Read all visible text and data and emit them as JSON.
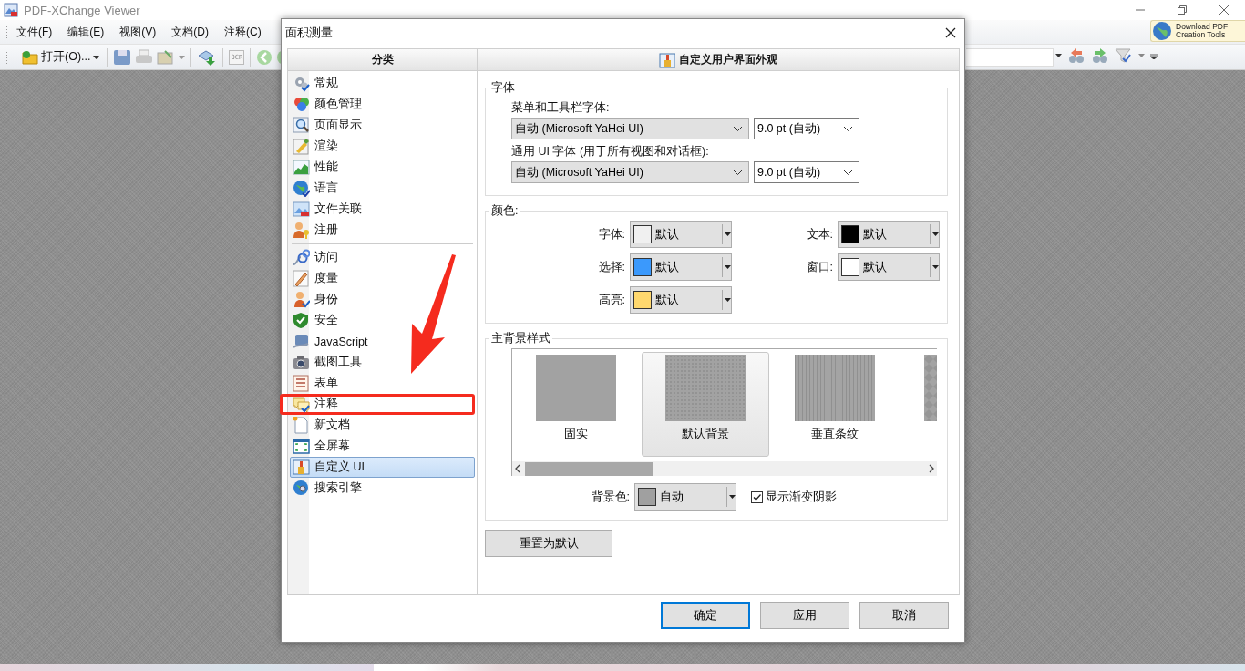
{
  "app": {
    "title": "PDF-XChange Viewer",
    "menu": [
      "文件(F)",
      "编辑(E)",
      "视图(V)",
      "文档(D)",
      "注释(C)"
    ],
    "open_button": "打开(O)...",
    "ocr_label": "OCR",
    "download_button": [
      "Download PDF",
      "Creation Tools"
    ]
  },
  "dialog": {
    "title": "面积测量",
    "categories_header": "分类",
    "category_groups": [
      [
        {
          "label": "常规",
          "selected": false
        },
        {
          "label": "颜色管理",
          "selected": false
        },
        {
          "label": "页面显示",
          "selected": false
        },
        {
          "label": "渲染",
          "selected": false
        },
        {
          "label": "性能",
          "selected": false
        },
        {
          "label": "语言",
          "selected": false
        },
        {
          "label": "文件关联",
          "selected": false
        },
        {
          "label": "注册",
          "selected": false
        }
      ],
      [
        {
          "label": "访问",
          "selected": false
        },
        {
          "label": "度量",
          "selected": false
        },
        {
          "label": "身份",
          "selected": false
        },
        {
          "label": "安全",
          "selected": false
        },
        {
          "label": "JavaScript",
          "selected": false
        },
        {
          "label": "截图工具",
          "selected": false
        },
        {
          "label": "表单",
          "selected": false
        },
        {
          "label": "注释",
          "selected": false,
          "highlighted": true
        },
        {
          "label": "新文档",
          "selected": false
        },
        {
          "label": "全屏幕",
          "selected": false
        },
        {
          "label": "自定义 UI",
          "selected": true
        },
        {
          "label": "搜索引擎",
          "selected": false
        }
      ]
    ],
    "page_header": "自定义用户界面外观",
    "font_group": {
      "title": "字体",
      "rows": [
        {
          "label": "菜单和工具栏字体:",
          "font": "自动 (Microsoft YaHei UI)",
          "size": "9.0 pt (自动)"
        },
        {
          "label": "通用 UI 字体 (用于所有视图和对话框):",
          "font": "自动 (Microsoft YaHei UI)",
          "size": "9.0 pt (自动)"
        }
      ]
    },
    "color_group": {
      "title": "颜色:",
      "items": [
        {
          "label": "字体:",
          "color": "#f0f0f0",
          "value": "默认"
        },
        {
          "label": "文本:",
          "color": "#000000",
          "value": "默认"
        },
        {
          "label": "选择:",
          "color": "#3b99fc",
          "value": "默认"
        },
        {
          "label": "窗口:",
          "color": "#ffffff",
          "value": "默认"
        },
        {
          "label": "高亮:",
          "color": "#ffd86e",
          "value": "默认"
        }
      ]
    },
    "background_group": {
      "title": "主背景样式",
      "styles": [
        {
          "kind": "solid",
          "label": "固实",
          "selected": false
        },
        {
          "kind": "dots",
          "label": "默认背景",
          "selected": true
        },
        {
          "kind": "stripes",
          "label": "垂直条纹",
          "selected": false
        },
        {
          "kind": "diamond",
          "selected": false
        }
      ],
      "color_label": "背景色:",
      "color": "#a0a0a0",
      "color_value": "自动",
      "gradient_label": "显示渐变阴影",
      "gradient_checked": true
    },
    "reset_button": "重置为默认",
    "buttons": [
      {
        "label": "确定",
        "default": true
      },
      {
        "label": "应用",
        "default": false
      },
      {
        "label": "取消",
        "default": false
      }
    ]
  }
}
